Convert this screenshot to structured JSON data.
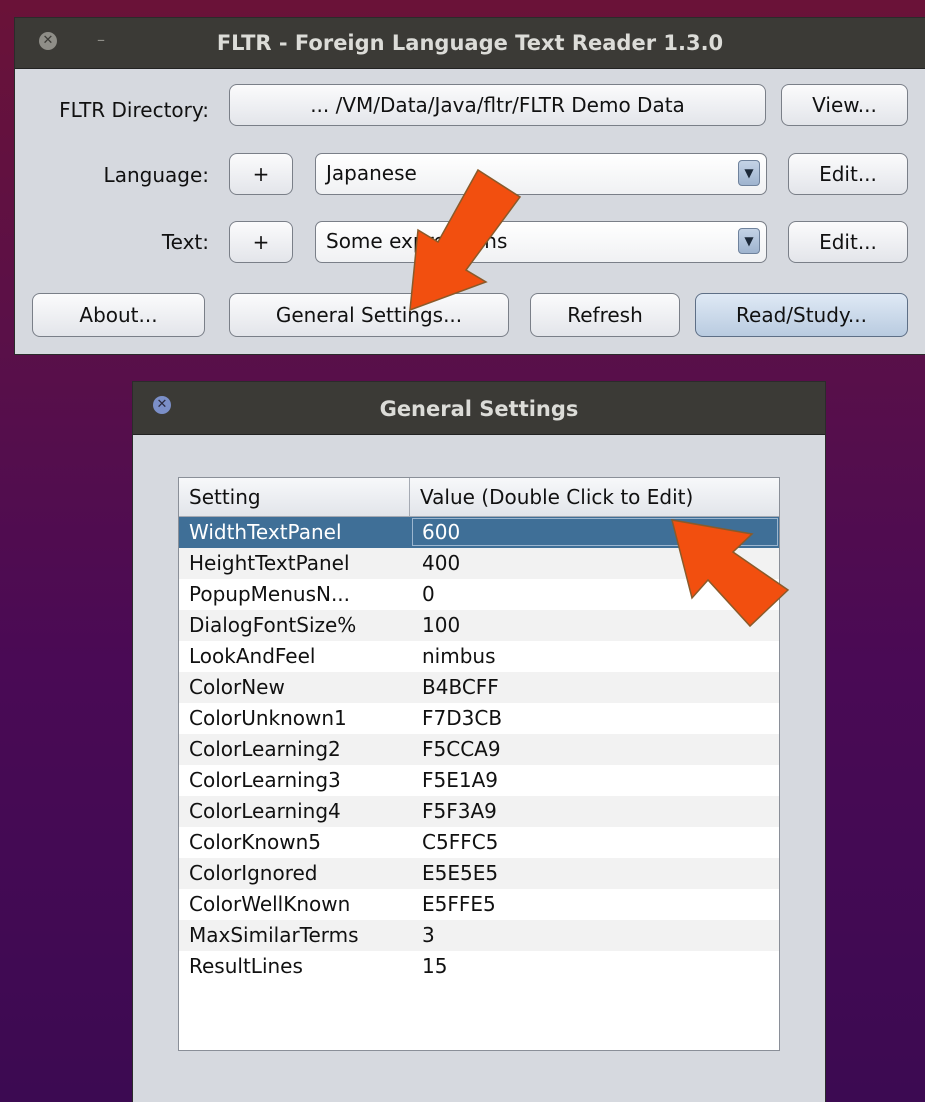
{
  "main_window": {
    "title": "FLTR - Foreign Language Text Reader 1.3.0",
    "fltr_directory_label": "FLTR Directory:",
    "fltr_directory_value": "... /VM/Data/Java/fltr/FLTR Demo Data",
    "view_button": "View...",
    "language_label": "Language:",
    "language_add": "+",
    "language_selected": "Japanese",
    "language_edit": "Edit...",
    "text_label": "Text:",
    "text_add": "+",
    "text_selected": "Some expressions",
    "text_edit": "Edit...",
    "about_button": "About...",
    "general_settings_button": "General Settings...",
    "refresh_button": "Refresh",
    "read_study_button": "Read/Study..."
  },
  "dialog": {
    "title": "General Settings",
    "columns": [
      "Setting",
      "Value (Double Click to Edit)"
    ],
    "rows": [
      {
        "setting": "WidthTextPanel",
        "value": "600"
      },
      {
        "setting": "HeightTextPanel",
        "value": "400"
      },
      {
        "setting": "PopupMenusN...",
        "value": "0"
      },
      {
        "setting": "DialogFontSize%",
        "value": "100"
      },
      {
        "setting": "LookAndFeel",
        "value": "nimbus"
      },
      {
        "setting": "ColorNew",
        "value": "B4BCFF"
      },
      {
        "setting": "ColorUnknown1",
        "value": "F7D3CB"
      },
      {
        "setting": "ColorLearning2",
        "value": "F5CCA9"
      },
      {
        "setting": "ColorLearning3",
        "value": "F5E1A9"
      },
      {
        "setting": "ColorLearning4",
        "value": "F5F3A9"
      },
      {
        "setting": "ColorKnown5",
        "value": "C5FFC5"
      },
      {
        "setting": "ColorIgnored",
        "value": "E5E5E5"
      },
      {
        "setting": "ColorWellKnown",
        "value": "E5FFE5"
      },
      {
        "setting": "MaxSimilarTerms",
        "value": "3"
      },
      {
        "setting": "ResultLines",
        "value": "15"
      }
    ]
  },
  "icons": {
    "close": "close-icon",
    "minimize": "minimize-icon",
    "dropdown": "chevron-down-icon",
    "annotation_arrow": "arrow-icon"
  },
  "colors": {
    "selection": "#3F6F97",
    "arrow": "#F24F0F"
  }
}
